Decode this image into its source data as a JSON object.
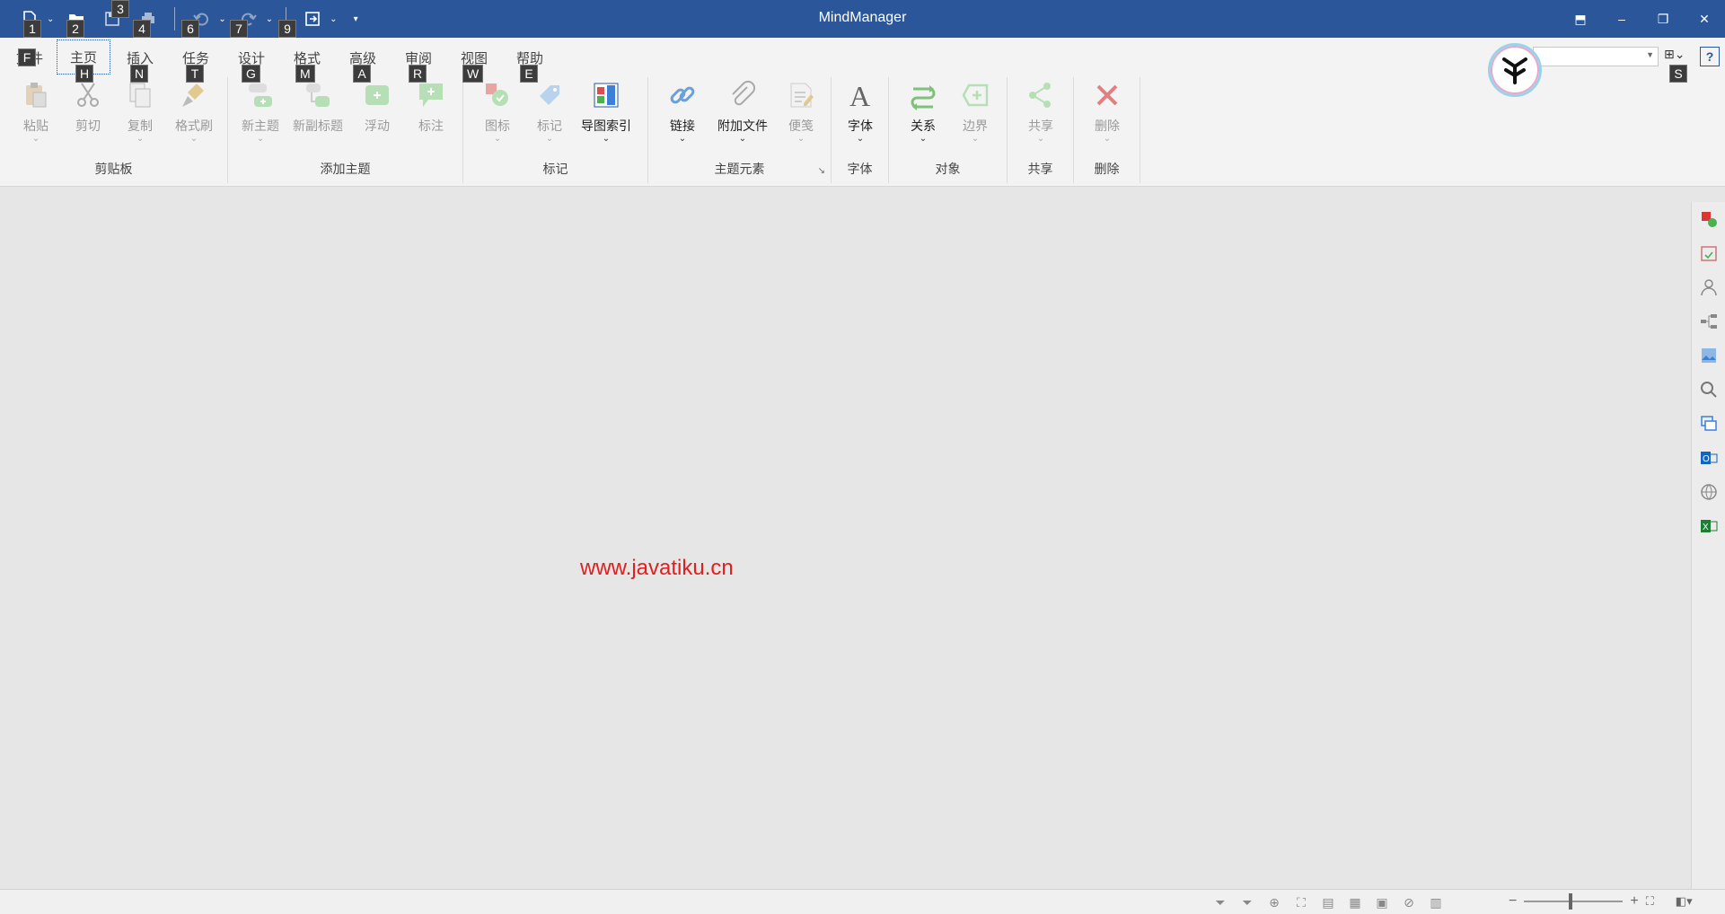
{
  "app": {
    "title": "MindManager",
    "accent": "#2b579a"
  },
  "qat": {
    "keytips": [
      "1",
      "2",
      "3",
      "4",
      "6",
      "7",
      "9"
    ]
  },
  "tabs": [
    {
      "label": "文件",
      "keytip": "F"
    },
    {
      "label": "主页",
      "keytip": "H"
    },
    {
      "label": "插入",
      "keytip": "N"
    },
    {
      "label": "任务",
      "keytip": "T"
    },
    {
      "label": "设计",
      "keytip": "G"
    },
    {
      "label": "格式",
      "keytip": "M"
    },
    {
      "label": "高级",
      "keytip": "A"
    },
    {
      "label": "审阅",
      "keytip": "R"
    },
    {
      "label": "视图",
      "keytip": "W"
    },
    {
      "label": "帮助",
      "keytip": "E"
    }
  ],
  "ribbon_right": {
    "keytip": "S"
  },
  "groups": {
    "clipboard": {
      "label": "剪贴板",
      "paste": "粘贴",
      "cut": "剪切",
      "copy": "复制",
      "format_painter": "格式刷"
    },
    "add_topic": {
      "label": "添加主题",
      "new_topic": "新主题",
      "new_subtopic": "新副标题",
      "floating": "浮动",
      "callout": "标注"
    },
    "markers": {
      "label": "标记",
      "icons": "图标",
      "tags": "标记",
      "map_index": "导图索引"
    },
    "topic_elements": {
      "label": "主题元素",
      "link": "链接",
      "attachment": "附加文件",
      "notes": "便笺"
    },
    "font": {
      "label": "字体",
      "font": "字体"
    },
    "objects": {
      "label": "对象",
      "relationship": "关系",
      "boundary": "边界"
    },
    "share": {
      "label": "共享",
      "share": "共享"
    },
    "delete": {
      "label": "删除",
      "delete": "删除"
    }
  },
  "canvas": {
    "watermark": "www.javatiku.cn"
  },
  "statusbar": {
    "zoom_minus": "−",
    "zoom_plus": "+"
  }
}
